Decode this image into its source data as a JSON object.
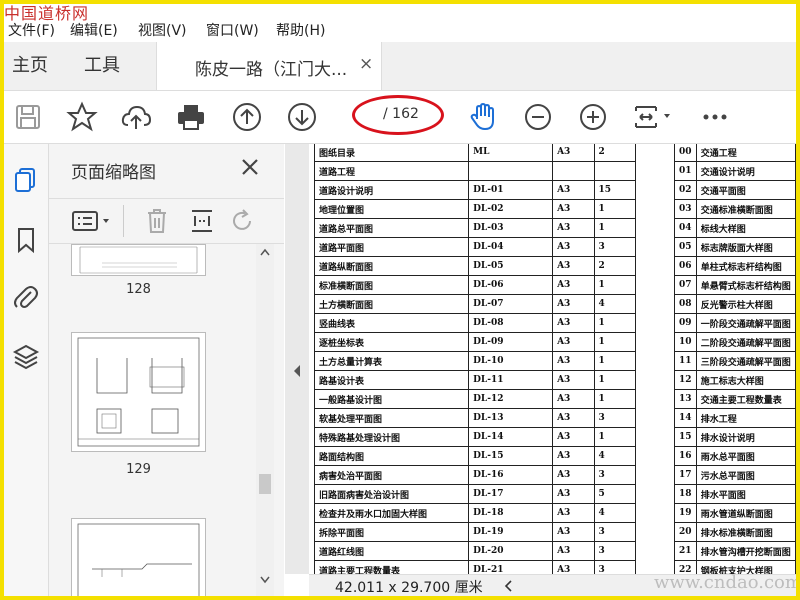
{
  "watermark_top": "中国道桥网",
  "menu": [
    "文件(F)",
    "编辑(E)",
    "视图(V)",
    "窗口(W)",
    "帮助(H)"
  ],
  "tabs": {
    "home": "主页",
    "tools": "工具",
    "document": "陈皮一路（江门大...",
    "close": "×"
  },
  "toolbar": {
    "page_current": "",
    "page_total": "/ 162"
  },
  "thumbnails": {
    "title": "页面缩略图",
    "pages": [
      "128",
      "129"
    ]
  },
  "document": {
    "left_table": [
      [
        "图纸目录",
        "ML",
        "A3",
        "2"
      ],
      [
        "道路工程",
        "",
        "",
        ""
      ],
      [
        "道路设计说明",
        "DL-01",
        "A3",
        "15"
      ],
      [
        "地理位置图",
        "DL-02",
        "A3",
        "1"
      ],
      [
        "道路总平面图",
        "DL-03",
        "A3",
        "1"
      ],
      [
        "道路平面图",
        "DL-04",
        "A3",
        "3"
      ],
      [
        "道路纵断面图",
        "DL-05",
        "A3",
        "2"
      ],
      [
        "标准横断面图",
        "DL-06",
        "A3",
        "1"
      ],
      [
        "土方横断面图",
        "DL-07",
        "A3",
        "4"
      ],
      [
        "竖曲线表",
        "DL-08",
        "A3",
        "1"
      ],
      [
        "逐桩坐标表",
        "DL-09",
        "A3",
        "1"
      ],
      [
        "土方总量计算表",
        "DL-10",
        "A3",
        "1"
      ],
      [
        "路基设计表",
        "DL-11",
        "A3",
        "1"
      ],
      [
        "一般路基设计图",
        "DL-12",
        "A3",
        "1"
      ],
      [
        "软基处理平面图",
        "DL-13",
        "A3",
        "3"
      ],
      [
        "特殊路基处理设计图",
        "DL-14",
        "A3",
        "1"
      ],
      [
        "路面结构图",
        "DL-15",
        "A3",
        "4"
      ],
      [
        "病害处治平面图",
        "DL-16",
        "A3",
        "3"
      ],
      [
        "旧路面病害处治设计图",
        "DL-17",
        "A3",
        "5"
      ],
      [
        "检查井及雨水口加固大样图",
        "DL-18",
        "A3",
        "4"
      ],
      [
        "拆除平面图",
        "DL-19",
        "A3",
        "3"
      ],
      [
        "道路红线图",
        "DL-20",
        "A3",
        "3"
      ],
      [
        "道路主要工程数量表",
        "DL-21",
        "A3",
        "3"
      ]
    ],
    "right_table": [
      [
        "00",
        "交通工程"
      ],
      [
        "01",
        "交通设计说明"
      ],
      [
        "02",
        "交通平面图"
      ],
      [
        "03",
        "交通标准横断面图"
      ],
      [
        "04",
        "标线大样图"
      ],
      [
        "05",
        "标志牌版面大样图"
      ],
      [
        "06",
        "单柱式标志杆结构图"
      ],
      [
        "07",
        "单悬臂式标志杆结构图"
      ],
      [
        "08",
        "反光警示柱大样图"
      ],
      [
        "09",
        "一阶段交通疏解平面图"
      ],
      [
        "10",
        "二阶段交通疏解平面图"
      ],
      [
        "11",
        "三阶段交通疏解平面图"
      ],
      [
        "12",
        "施工标志大样图"
      ],
      [
        "13",
        "交通主要工程数量表"
      ],
      [
        "14",
        "排水工程"
      ],
      [
        "15",
        "排水设计说明"
      ],
      [
        "16",
        "雨水总平面图"
      ],
      [
        "17",
        "污水总平面图"
      ],
      [
        "18",
        "排水平面图"
      ],
      [
        "19",
        "雨水管道纵断面图"
      ],
      [
        "20",
        "排水标准横断面图"
      ],
      [
        "21",
        "排水管沟槽开挖断面图"
      ],
      [
        "22",
        "钢板桩支护大样图"
      ]
    ]
  },
  "status": {
    "page_size": "42.011 x 29.700 厘米"
  },
  "watermark_bottom": "www.cndao.com",
  "colors": {
    "accent": "#d8121c",
    "frame": "#f4e000",
    "icon_blue": "#1d6fd6"
  }
}
